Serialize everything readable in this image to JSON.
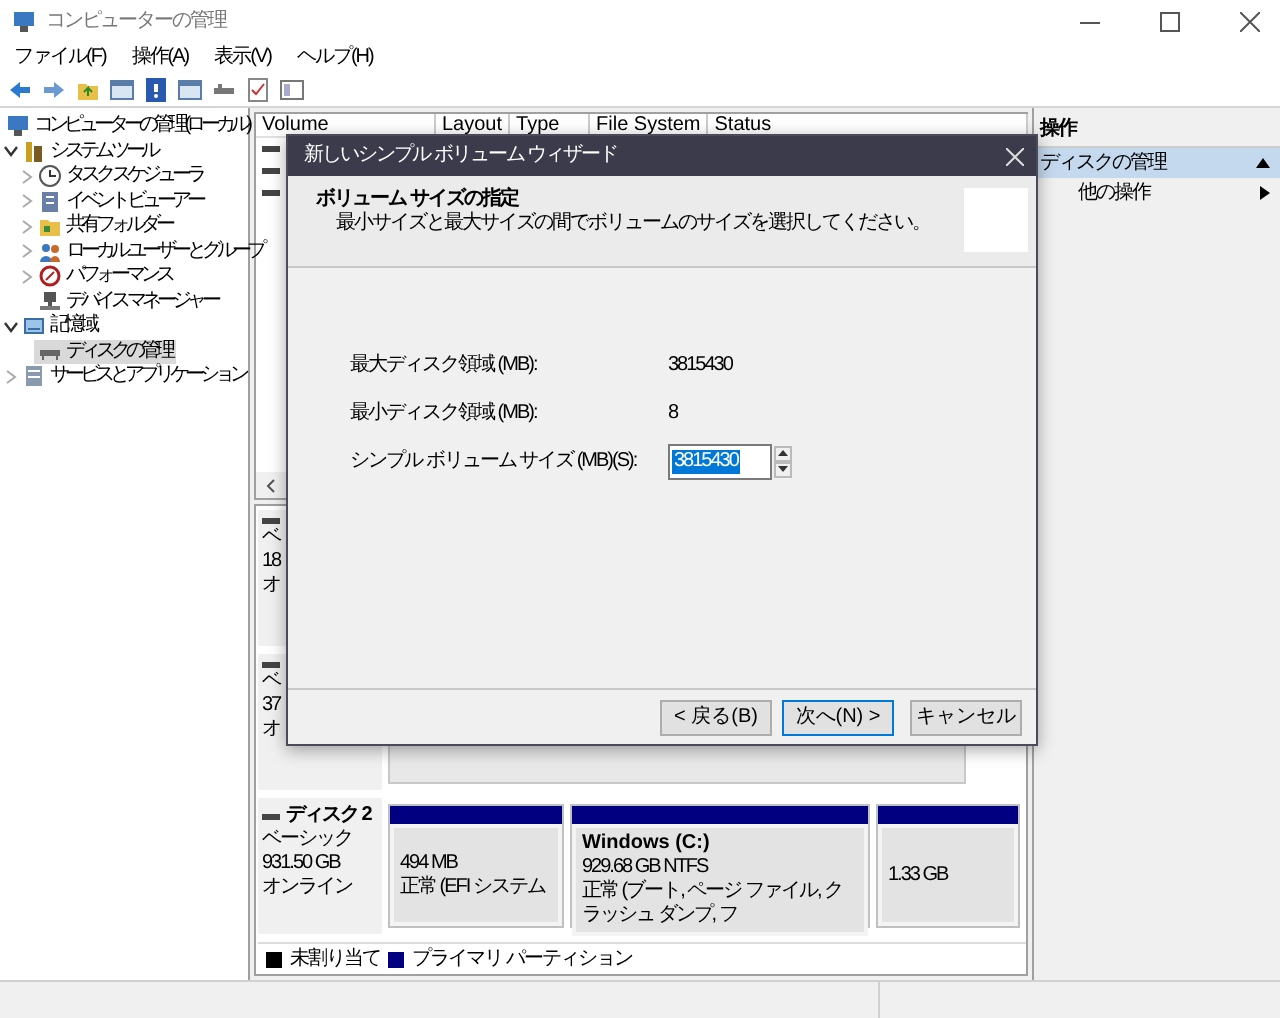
{
  "window": {
    "title": "コンピューターの管理"
  },
  "menu": [
    "ファイル(F)",
    "操作(A)",
    "表示(V)",
    "ヘルプ(H)"
  ],
  "tree": [
    {
      "label": "コンピューターの管理 (ローカル)",
      "expandable": false,
      "selected": false,
      "children": [
        {
          "label": "システム ツール",
          "expandable": true,
          "expanded": true,
          "selected": false,
          "children": [
            {
              "label": "タスク スケジューラ",
              "expandable": true,
              "expanded": false,
              "selected": false
            },
            {
              "label": "イベント ビューアー",
              "expandable": true,
              "expanded": false,
              "selected": false
            },
            {
              "label": "共有フォルダー",
              "expandable": true,
              "expanded": false,
              "selected": false
            },
            {
              "label": "ローカル ユーザーとグループ",
              "expandable": true,
              "expanded": false,
              "selected": false
            },
            {
              "label": "パフォーマンス",
              "expandable": true,
              "expanded": false,
              "selected": false
            },
            {
              "label": "デバイス マネージャー",
              "expandable": false,
              "selected": false
            }
          ]
        },
        {
          "label": "記憶域",
          "expandable": true,
          "expanded": true,
          "selected": false,
          "children": [
            {
              "label": "ディスクの管理",
              "expandable": false,
              "selected": true
            }
          ]
        },
        {
          "label": "サービスとアプリケーション",
          "expandable": true,
          "expanded": false,
          "selected": false
        }
      ]
    }
  ],
  "volume_table": {
    "columns": [
      "Volume",
      "Layout",
      "Type",
      "File System",
      "Status"
    ],
    "rows": [
      {
        "kind": "volume"
      },
      {
        "kind": "volume"
      },
      {
        "kind": "volume"
      }
    ]
  },
  "disks": [
    {
      "lines": [
        "ベ",
        "18",
        "オ"
      ]
    },
    {
      "lines": [
        "ベ",
        "37",
        "オ"
      ]
    },
    {
      "name": "ディスク 2",
      "lines": [
        "ベーシック",
        "931.50 GB",
        "オンライン"
      ],
      "partitions": [
        {
          "color": "#000080",
          "lines": [
            "494 MB",
            "正常 (EFI システム"
          ]
        },
        {
          "color": "#000080",
          "title": "Windows  (C:)",
          "lines": [
            "929.68 GB NTFS",
            "正常 (ブート, ページ ファイル, クラッシュ ダンプ, フ"
          ]
        },
        {
          "color": "#000080",
          "lines": [
            "1.33 GB"
          ]
        }
      ]
    }
  ],
  "legend": [
    {
      "label": "未割り当て",
      "color": "#000000"
    },
    {
      "label": "プライマリ パーティション",
      "color": "#000080"
    }
  ],
  "actions": {
    "title": "操作",
    "items": [
      {
        "label": "ディスクの管理",
        "kind": "section",
        "selected": true
      },
      {
        "label": "他の操作",
        "kind": "item",
        "selected": false
      }
    ]
  },
  "dialog": {
    "title": "新しいシンプル ボリューム ウィザード",
    "heading": "ボリューム サイズの指定",
    "subtitle": "最小サイズと最大サイズの間でボリュームのサイズを選択してください。",
    "fields": [
      {
        "kind": "text",
        "label": "最大ディスク領域 (MB):",
        "value": "3815430"
      },
      {
        "kind": "text",
        "label": "最小ディスク領域 (MB):",
        "value": "8"
      },
      {
        "kind": "spin",
        "label": "シンプル ボリューム サイズ (MB)(S):",
        "value": "3815430",
        "highlighted": true
      }
    ],
    "buttons": [
      {
        "label": "< 戻る(B)",
        "default": false
      },
      {
        "label": "次へ(N) >",
        "default": true
      },
      {
        "label": "キャンセル",
        "default": false
      }
    ]
  }
}
